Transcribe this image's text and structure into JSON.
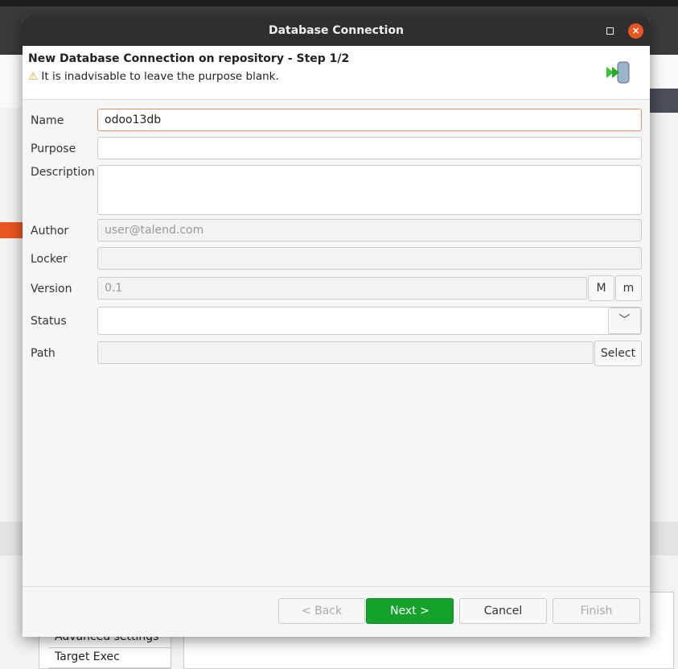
{
  "background": {
    "items": [
      "Advanced settings",
      "Target Exec"
    ]
  },
  "dialog": {
    "title": "Database Connection",
    "header_title": "New Database Connection on repository - Step 1/2",
    "warning": "It is inadvisable to leave the purpose blank.",
    "fields": {
      "name": {
        "label": "Name",
        "value": "odoo13db"
      },
      "purpose": {
        "label": "Purpose",
        "value": ""
      },
      "description": {
        "label": "Description",
        "value": ""
      },
      "author": {
        "label": "Author",
        "value": "user@talend.com"
      },
      "locker": {
        "label": "Locker",
        "value": ""
      },
      "version": {
        "label": "Version",
        "value": "0.1",
        "major": "M",
        "minor": "m"
      },
      "status": {
        "label": "Status",
        "value": ""
      },
      "path": {
        "label": "Path",
        "value": "",
        "select": "Select"
      }
    },
    "buttons": {
      "back": "< Back",
      "next": "Next >",
      "cancel": "Cancel",
      "finish": "Finish"
    }
  },
  "colors": {
    "accent": "#14a22c",
    "close": "#e95420"
  }
}
